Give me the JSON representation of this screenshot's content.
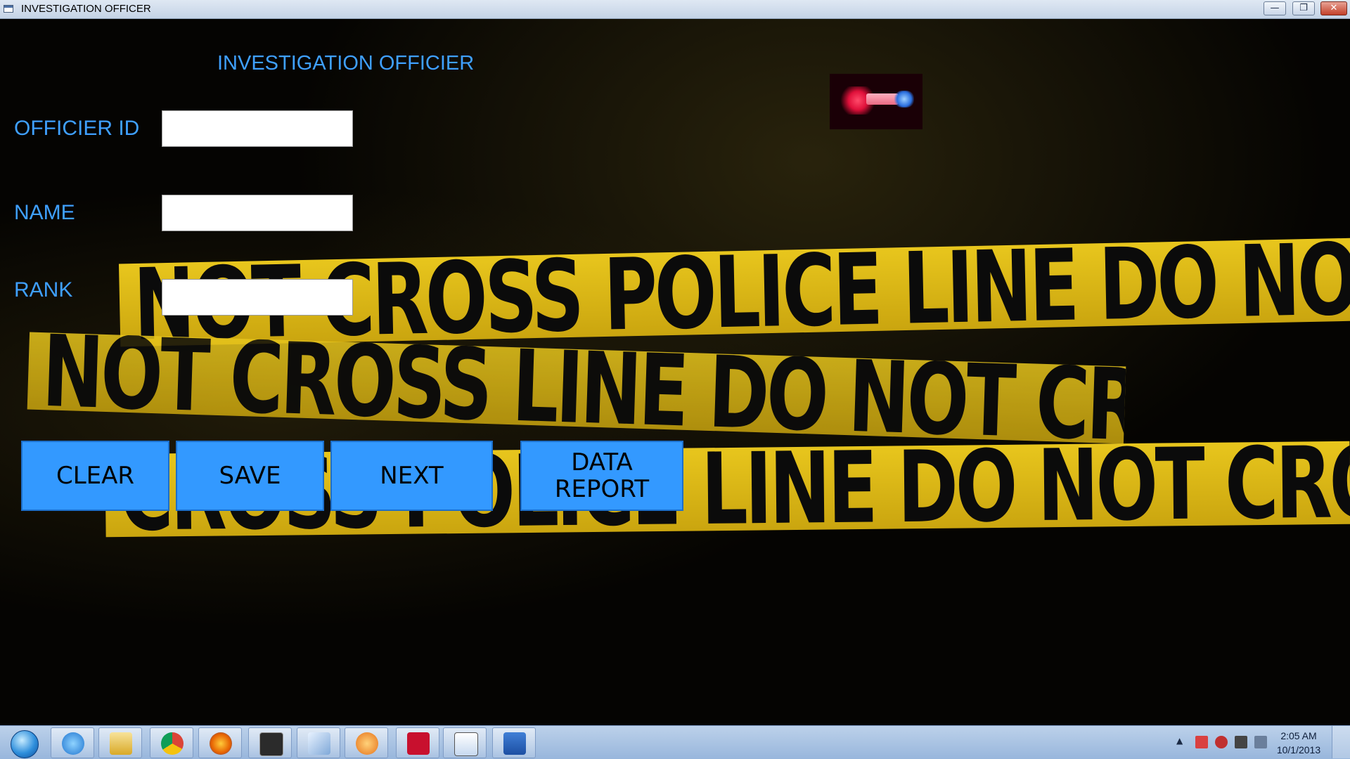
{
  "window": {
    "title": "INVESTIGATION OFFICER",
    "controls": {
      "minimize": "—",
      "maximize": "❐",
      "close": "✕"
    }
  },
  "form": {
    "title": "INVESTIGATION OFFICIER",
    "fields": {
      "officer_id": {
        "label": "OFFICIER ID",
        "value": ""
      },
      "name": {
        "label": "NAME",
        "value": ""
      },
      "rank": {
        "label": "RANK",
        "value": ""
      }
    },
    "buttons": {
      "clear": "CLEAR",
      "save": "SAVE",
      "next": "NEXT",
      "data_report_line1": "DATA",
      "data_report_line2": "REPORT"
    }
  },
  "background": {
    "tape_texts": [
      "NOT CROSS    POLICE LINE DO NOT CR",
      "NOT CROSS  LINE DO NOT CROSS     POLI",
      "CROSS   POLICE LINE DO NOT CROSS"
    ]
  },
  "taskbar": {
    "pinned": [
      "internet-explorer-icon",
      "file-explorer-icon",
      "chrome-icon",
      "firefox-icon",
      "sql-icon",
      "notepad-icon",
      "media-player-icon",
      "adobe-reader-icon",
      "remote-app-icon",
      "word-icon"
    ],
    "clock": {
      "time": "2:05 AM",
      "date": "10/1/2013"
    }
  },
  "colors": {
    "accent_blue": "#3399ff",
    "label_blue": "#3fa0ff",
    "tape_yellow": "#e8c61d"
  }
}
